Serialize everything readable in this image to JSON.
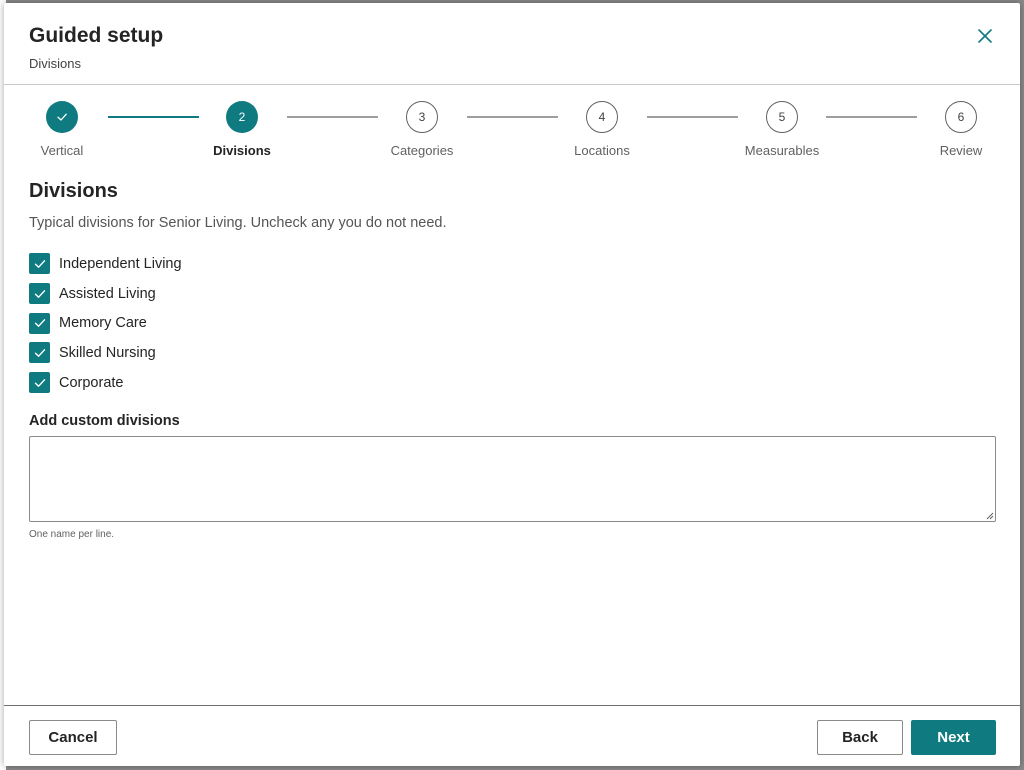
{
  "dialog": {
    "title": "Guided setup",
    "subtitle": "Divisions"
  },
  "colors": {
    "accent": "#0f7b80",
    "step_todo_border": "#616161"
  },
  "stepper": {
    "steps": [
      {
        "number": "",
        "label": "Vertical",
        "state": "done",
        "icon": "check-icon"
      },
      {
        "number": "2",
        "label": "Divisions",
        "state": "active"
      },
      {
        "number": "3",
        "label": "Categories",
        "state": "todo"
      },
      {
        "number": "4",
        "label": "Locations",
        "state": "todo"
      },
      {
        "number": "5",
        "label": "Measurables",
        "state": "todo"
      },
      {
        "number": "6",
        "label": "Review",
        "state": "todo"
      }
    ]
  },
  "section": {
    "title": "Divisions",
    "description": "Typical divisions for Senior Living. Uncheck any you do not need."
  },
  "divisions": [
    {
      "label": "Independent Living",
      "checked": true
    },
    {
      "label": "Assisted Living",
      "checked": true
    },
    {
      "label": "Memory Care",
      "checked": true
    },
    {
      "label": "Skilled Nursing",
      "checked": true
    },
    {
      "label": "Corporate",
      "checked": true
    }
  ],
  "custom": {
    "label": "Add custom divisions",
    "value": "",
    "hint": "One name per line."
  },
  "footer": {
    "cancel_label": "Cancel",
    "back_label": "Back",
    "next_label": "Next"
  }
}
